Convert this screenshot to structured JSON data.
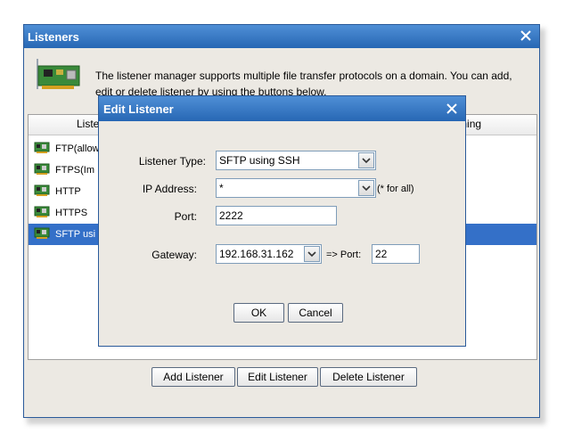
{
  "main_window": {
    "title": "Listeners",
    "description": "The listener manager supports multiple file transfer protocols on a domain. You can add, edit or delete listener by using the buttons below.",
    "columns": [
      "Listener",
      "Listening"
    ],
    "rows": [
      {
        "label": "FTP(allow"
      },
      {
        "label": "FTPS(Im"
      },
      {
        "label": "HTTP"
      },
      {
        "label": "HTTPS"
      },
      {
        "label": "SFTP usi",
        "selected": true
      }
    ],
    "buttons": {
      "add": "Add Listener",
      "edit": "Edit Listener",
      "delete": "Delete Listener"
    }
  },
  "dialog": {
    "title": "Edit Listener",
    "listener_type_label": "Listener Type:",
    "listener_type_value": "SFTP using SSH",
    "ip_label": "IP Address:",
    "ip_value": "*",
    "ip_hint": "(* for all)",
    "port_label": "Port:",
    "port_value": "2222",
    "gateway_label": "Gateway:",
    "gateway_value": "192.168.31.162",
    "gateway_port_label": "=> Port:",
    "gateway_port_value": "22",
    "ok": "OK",
    "cancel": "Cancel"
  },
  "icons": {
    "close": "close-icon",
    "network_card": "network-card-icon",
    "dropdown": "chevron-down-icon"
  },
  "colors": {
    "titlebar": "#2f72c4",
    "selection": "#3470c8",
    "window_bg": "#ece9e3"
  }
}
